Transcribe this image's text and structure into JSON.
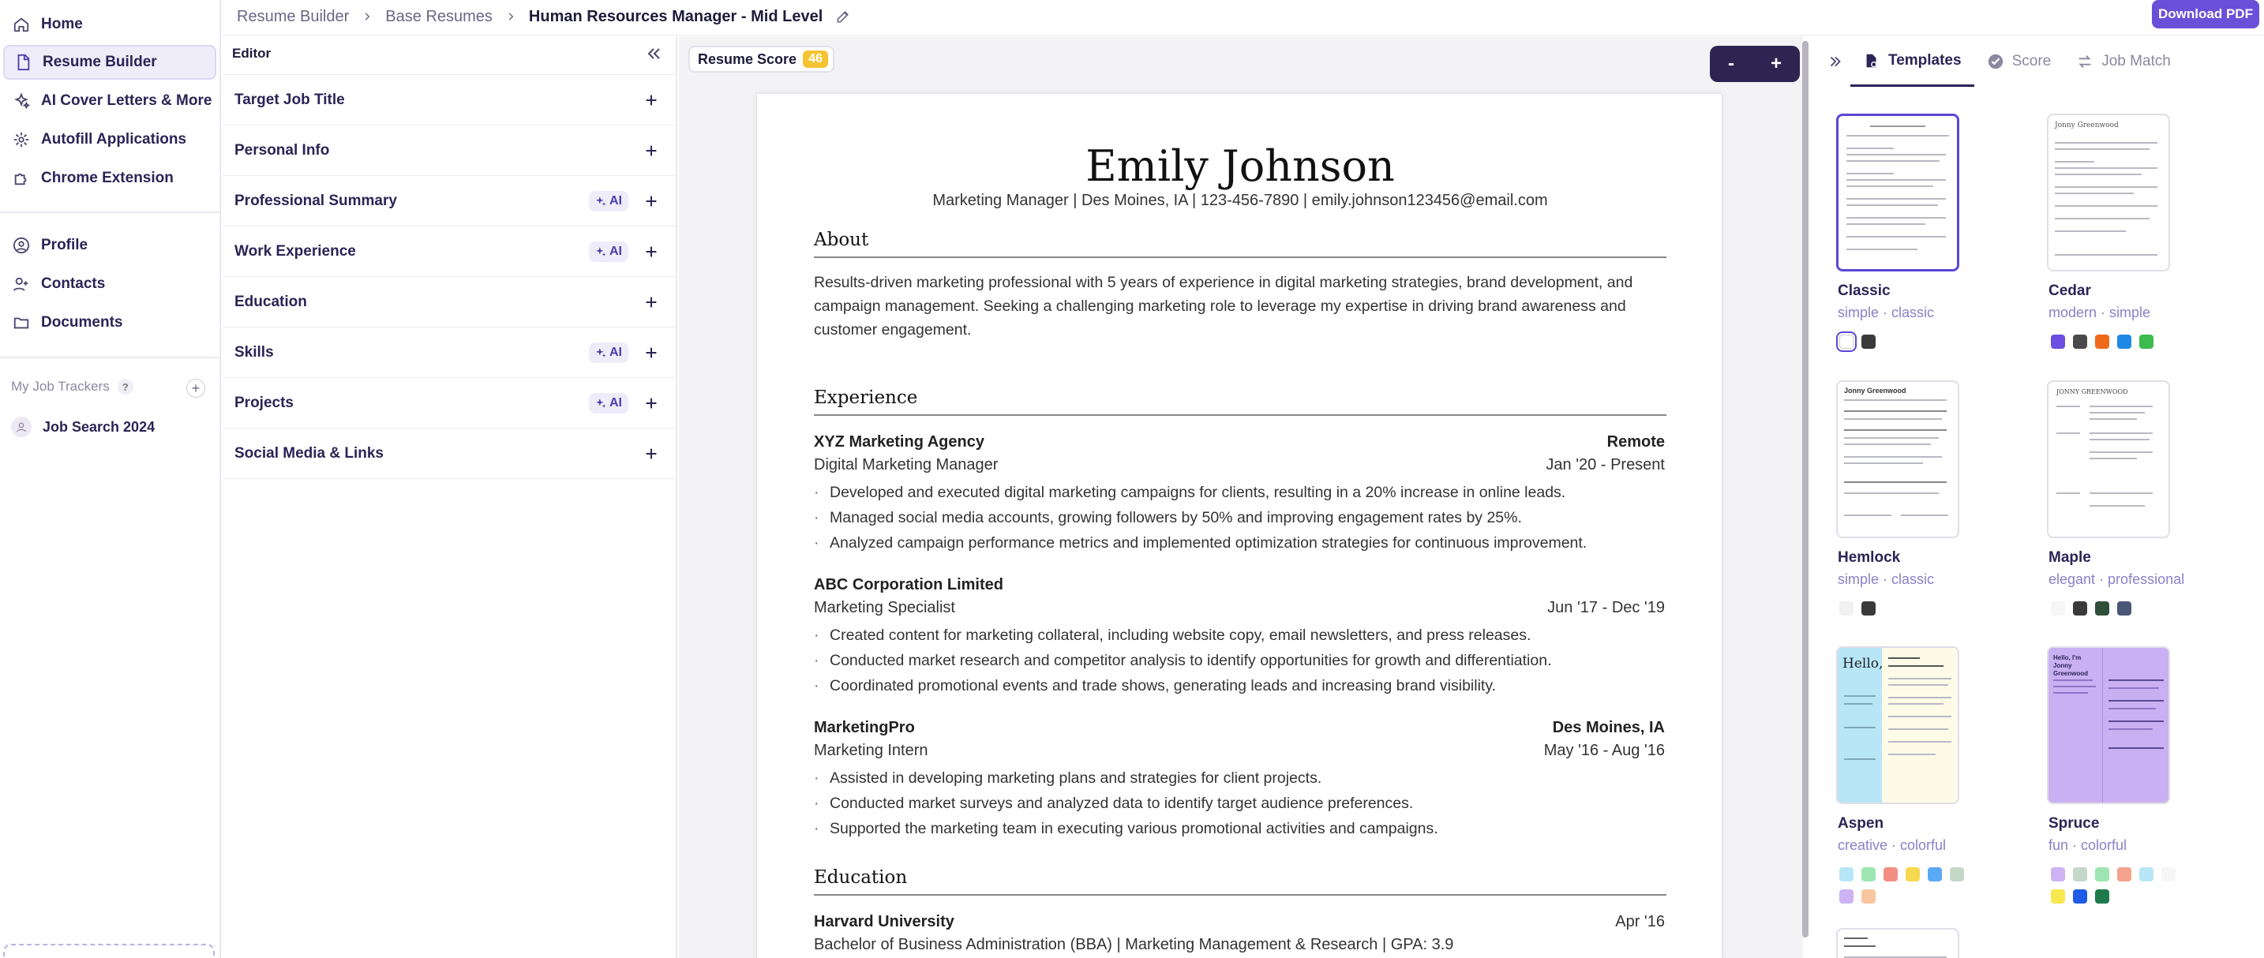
{
  "sidebar": {
    "nav": [
      {
        "label": "Home",
        "icon": "home-icon"
      },
      {
        "label": "Resume Builder",
        "icon": "document-icon",
        "active": true
      },
      {
        "label": "AI Cover Letters & More",
        "icon": "sparkles-icon"
      },
      {
        "label": "Autofill Applications",
        "icon": "autofill-icon"
      },
      {
        "label": "Chrome Extension",
        "icon": "puzzle-icon"
      }
    ],
    "nav2": [
      {
        "label": "Profile",
        "icon": "user-circle-icon"
      },
      {
        "label": "Contacts",
        "icon": "contacts-icon"
      },
      {
        "label": "Documents",
        "icon": "folder-icon"
      }
    ],
    "trackers_title": "My Job Trackers",
    "trackers_help": "?",
    "tracker_add": "+",
    "tracker_item": "Job Search 2024"
  },
  "breadcrumb": {
    "items": [
      "Resume Builder",
      "Base Resumes"
    ],
    "current": "Human Resources Manager - Mid Level"
  },
  "download_label": "Download PDF",
  "editor": {
    "title": "Editor",
    "sections": [
      {
        "label": "Target Job Title",
        "ai": false
      },
      {
        "label": "Personal Info",
        "ai": false
      },
      {
        "label": "Professional Summary",
        "ai": true
      },
      {
        "label": "Work Experience",
        "ai": true
      },
      {
        "label": "Education",
        "ai": false
      },
      {
        "label": "Skills",
        "ai": true
      },
      {
        "label": "Projects",
        "ai": true
      },
      {
        "label": "Social Media & Links",
        "ai": false
      }
    ],
    "ai_label": "AI"
  },
  "preview": {
    "score_label": "Resume Score",
    "score_value": "46",
    "zoom_out": "-",
    "zoom_in": "+"
  },
  "resume": {
    "name": "Emily Johnson",
    "contact": "Marketing Manager  |  Des Moines, IA  |  123-456-7890  |  emily.johnson123456@email.com",
    "about_title": "About",
    "about_text": "Results-driven marketing professional with 5 years of experience in digital marketing strategies, brand development, and campaign management. Seeking a challenging marketing role to leverage my expertise in driving brand awareness and customer engagement.",
    "experience_title": "Experience",
    "jobs": [
      {
        "company": "XYZ Marketing Agency",
        "location": "Remote",
        "role": "Digital Marketing Manager",
        "dates": "Jan '20 - Present",
        "bullets": [
          "Developed and executed digital marketing campaigns for clients, resulting in a 20% increase in online leads.",
          "Managed social media accounts, growing followers by 50% and improving engagement rates by 25%.",
          "Analyzed campaign performance metrics and implemented optimization strategies for continuous improvement."
        ]
      },
      {
        "company": "ABC Corporation Limited",
        "location": "",
        "role": "Marketing Specialist",
        "dates": "Jun '17 - Dec '19",
        "bullets": [
          "Created content for marketing collateral, including website copy, email newsletters, and press releases.",
          "Conducted market research and competitor analysis to identify opportunities for growth and differentiation.",
          "Coordinated promotional events and trade shows, generating leads and increasing brand visibility."
        ]
      },
      {
        "company": "MarketingPro",
        "location": "Des Moines, IA",
        "role": "Marketing Intern",
        "dates": "May '16 - Aug '16",
        "bullets": [
          "Assisted in developing marketing plans and strategies for client projects.",
          "Conducted market surveys and analyzed data to identify target audience preferences.",
          "Supported the marketing team in executing various promotional activities and campaigns."
        ]
      }
    ],
    "education_title": "Education",
    "school": "Harvard University",
    "school_date": "Apr '16",
    "degree": "Bachelor of Business Administration (BBA) | Marketing Management & Research | GPA: 3.9"
  },
  "templates_panel": {
    "tabs": [
      {
        "label": "Templates",
        "icon": "template-icon",
        "active": true
      },
      {
        "label": "Score",
        "icon": "check-circle-icon",
        "active": false
      },
      {
        "label": "Job Match",
        "icon": "arrows-icon",
        "active": false
      }
    ],
    "templates": [
      {
        "name": "Classic",
        "tags": "simple · classic",
        "colors": [
          "#ffffff",
          "#3a3a3a"
        ],
        "selected_color": 0,
        "selected": true
      },
      {
        "name": "Cedar",
        "tags": "modern · simple",
        "colors": [
          "#6b4fe0",
          "#4a4a4a",
          "#f06a1a",
          "#1e88e5",
          "#3dbb4c"
        ]
      },
      {
        "name": "Hemlock",
        "tags": "simple · classic",
        "colors": [
          "#f1f1f1",
          "#3a3a3a"
        ]
      },
      {
        "name": "Maple",
        "tags": "elegant · professional",
        "colors": [
          "#f6f6f6",
          "#3a3a3a",
          "#2f4f3a",
          "#4a5878"
        ]
      },
      {
        "name": "Aspen",
        "tags": "creative · colorful",
        "colors": [
          "#b7e6f7",
          "#9de6b1",
          "#f48d84",
          "#f6d94e",
          "#5aa9f4",
          "#c4d8c8",
          "#cdb3f4",
          "#f8c7a0"
        ]
      },
      {
        "name": "Spruce",
        "tags": "fun · colorful",
        "colors": [
          "#cdb3f4",
          "#c4d8c8",
          "#9de6b1",
          "#f4a38d",
          "#b7e6f7",
          "#f6f6f6",
          "#f6e84e",
          "#1e5be6",
          "#1e7a4c"
        ]
      }
    ],
    "thumb_texts": {
      "aspen_hello": "Hello,",
      "spruce_hello": "Hello, I'm Jonny Greenwood",
      "maple_name": "JONNY GREENWOOD",
      "hemlock_name": "Jonny Greenwood",
      "cedar_name": "Jonny Greenwood"
    }
  }
}
